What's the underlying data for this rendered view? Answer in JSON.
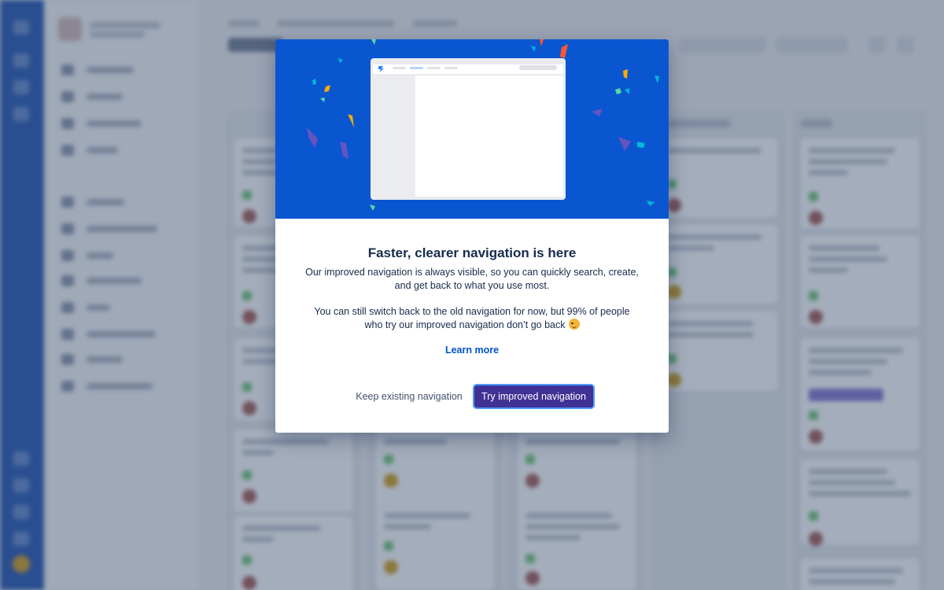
{
  "modal": {
    "title": "Faster, clearer navigation is here",
    "paragraph_1": "Our improved navigation is always visible, so you can quickly search, create, and get back to what you use most.",
    "paragraph_2": "You can still switch back to the old navigation for now, but 99% of people who try our improved navigation don’t go back",
    "emoji": "wink-emoji",
    "learn_more": "Learn more",
    "keep_button": "Keep existing navigation",
    "try_button": "Try improved navigation"
  },
  "colors": {
    "hero_background": "#0a56d0",
    "primary_button": "#403294",
    "link": "#0052cc",
    "text": "#172b4d",
    "global_nav": "#3a66b6"
  }
}
